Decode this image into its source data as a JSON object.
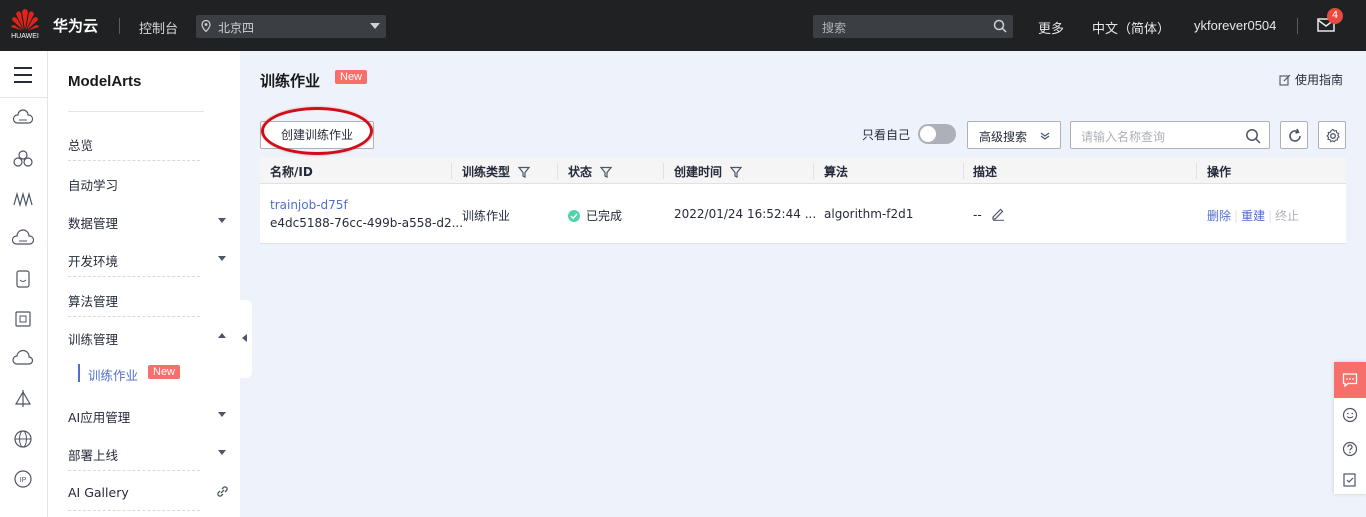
{
  "topbar": {
    "logo_text": "HUAWEI",
    "brand": "华为云",
    "console": "控制台",
    "region": "北京四",
    "search_placeholder": "搜索",
    "more": "更多",
    "language": "中文（简体）",
    "username": "ykforever0504",
    "mail_count": "4"
  },
  "sidebar": {
    "title": "ModelArts",
    "items": [
      {
        "label": "总览",
        "expandable": "none"
      },
      {
        "label": "自动学习",
        "expandable": "none"
      },
      {
        "label": "数据管理",
        "expandable": "down"
      },
      {
        "label": "开发环境",
        "expandable": "down"
      },
      {
        "label": "算法管理",
        "expandable": "none"
      },
      {
        "label": "训练管理",
        "expandable": "up"
      },
      {
        "label": "AI应用管理",
        "expandable": "down"
      },
      {
        "label": "部署上线",
        "expandable": "down"
      },
      {
        "label": "AI Gallery",
        "expandable": "link"
      }
    ],
    "active_sub": {
      "label": "训练作业",
      "tag": "New"
    }
  },
  "page": {
    "title": "训练作业",
    "title_tag": "New",
    "guide": "使用指南"
  },
  "toolbar": {
    "create_label": "创建训练作业",
    "only_mine_label": "只看自己",
    "only_mine_on": false,
    "advanced_search": "高级搜索",
    "name_search_placeholder": "请输入名称查询"
  },
  "table": {
    "columns": [
      "名称/ID",
      "训练类型",
      "状态",
      "创建时间",
      "算法",
      "描述",
      "操作"
    ],
    "rows": [
      {
        "name": "trainjob-d75f",
        "id": "e4dc5188-76cc-499b-a558-d2...",
        "type": "训练作业",
        "status": "已完成",
        "created": "2022/01/24 16:52:44 ...",
        "algorithm": "algorithm-f2d1",
        "description": "--",
        "actions": [
          "删除",
          "重建",
          "终止"
        ]
      }
    ]
  },
  "colors": {
    "accent": "#526ecc",
    "topbar": "#1f2123",
    "new_tag": "#f66f6a",
    "success": "#50d4ab",
    "highlight_ellipse": "#d10d18"
  }
}
